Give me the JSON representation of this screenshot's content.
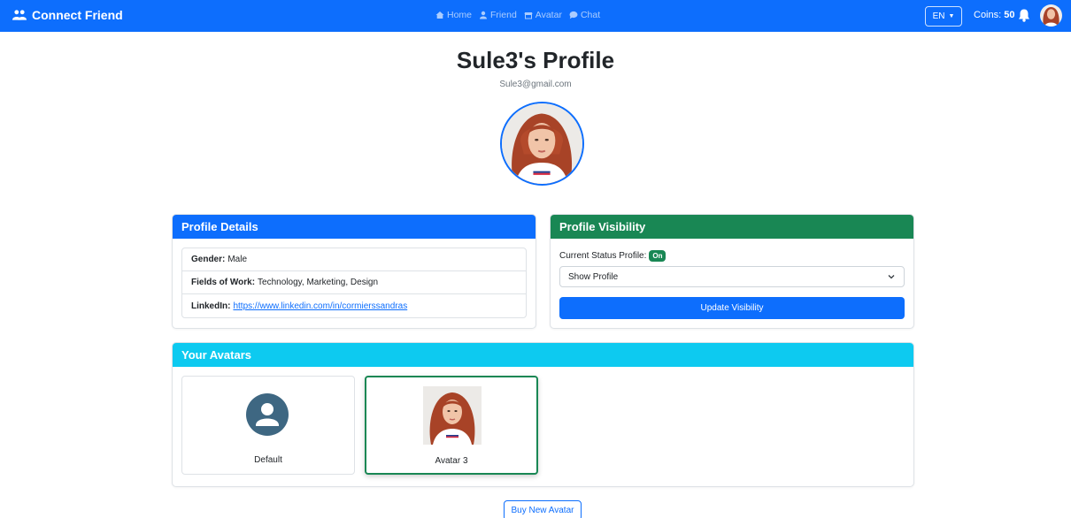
{
  "navbar": {
    "brand": "Connect Friend",
    "links": [
      {
        "label": "Home",
        "icon": "home-icon"
      },
      {
        "label": "Friend",
        "icon": "user-icon"
      },
      {
        "label": "Avatar",
        "icon": "store-icon"
      },
      {
        "label": "Chat",
        "icon": "chat-icon"
      }
    ],
    "language": "EN",
    "coins_label": "Coins:",
    "coins_value": "50"
  },
  "profile": {
    "title": "Sule3's Profile",
    "email": "Sule3@gmail.com"
  },
  "details": {
    "header": "Profile Details",
    "gender_label": "Gender:",
    "gender_value": "Male",
    "fields_label": "Fields of Work:",
    "fields_value": "Technology, Marketing, Design",
    "linkedin_label": "LinkedIn:",
    "linkedin_value": "https://www.linkedin.com/in/cormierssandras"
  },
  "visibility": {
    "header": "Profile Visibility",
    "status_label": "Current Status Profile:",
    "status_badge": "On",
    "select_value": "Show Profile",
    "update_button": "Update Visibility"
  },
  "avatars": {
    "header": "Your Avatars",
    "items": [
      {
        "label": "Default"
      },
      {
        "label": "Avatar 3"
      }
    ]
  },
  "buy_button": "Buy New Avatar",
  "colors": {
    "primary": "#0d6efd",
    "success": "#198754",
    "info": "#0dcaf0"
  }
}
